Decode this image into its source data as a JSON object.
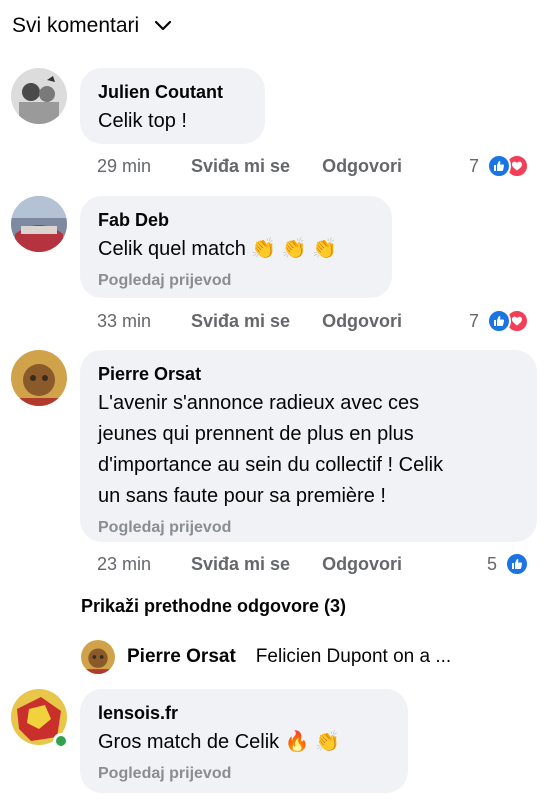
{
  "header": {
    "label": "Svi komentari",
    "icon": "chevron-down-icon"
  },
  "comments": [
    {
      "author": "Julien Coutant",
      "text": "Celik top !",
      "translate": "",
      "time": "29 min",
      "like": "Sviđa mi se",
      "reply": "Odgovori",
      "reactions": "7",
      "reaction_types": [
        "like",
        "love"
      ]
    },
    {
      "author": "Fab Deb",
      "text": "Celik quel match",
      "emojis": "👏 👏 👏",
      "translate": "Pogledaj prijevod",
      "time": "33 min",
      "like": "Sviđa mi se",
      "reply": "Odgovori",
      "reactions": "7",
      "reaction_types": [
        "like",
        "love"
      ]
    },
    {
      "author": "Pierre Orsat",
      "text_lines": [
        "L'avenir s'annonce radieux avec ces",
        "jeunes qui prennent de plus en plus",
        "d'importance au sein du collectif ! Celik",
        "un sans faute pour sa première !"
      ],
      "translate": "Pogledaj prijevod",
      "time": "23 min",
      "like": "Sviđa mi se",
      "reply": "Odgovori",
      "reactions": "5",
      "reaction_types": [
        "like"
      ]
    },
    {
      "author": "lensois.fr",
      "text": "Gros match de Celik",
      "emojis": "🔥 👏",
      "translate": "Pogledaj prijevod",
      "online": true
    }
  ],
  "replies": {
    "show_label": "Prikaži prethodne odgovore (3)",
    "preview_author": "Pierre Orsat",
    "preview_text": "Felicien Dupont on a ..."
  },
  "colors": {
    "bubble": "#f0f2f5",
    "meta": "#65676b",
    "translate": "#8a8d91",
    "like_blue": "#1b74e4",
    "love_red": "#f33e58",
    "online_green": "#31a24c"
  }
}
